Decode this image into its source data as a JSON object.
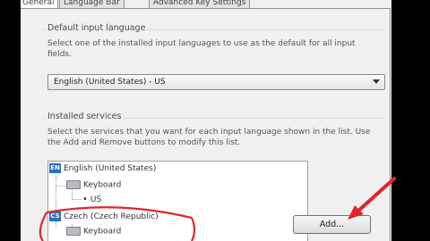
{
  "tabs": [
    {
      "label": "General",
      "active": true
    },
    {
      "label": "Language Bar",
      "active": false
    },
    {
      "label": "Advanced Key Settings",
      "active": false
    }
  ],
  "default_language": {
    "group_title": "Default input language",
    "description": "Select one of the installed input languages to use as the default for all input fields.",
    "selected": "English (United States) - US"
  },
  "installed_services": {
    "group_title": "Installed services",
    "description": "Select the services that you want for each input language shown in the list. Use the Add and Remove buttons to modify this list.",
    "languages": [
      {
        "badge": "EN",
        "name": "English (United States)",
        "category": "Keyboard",
        "layout": "US"
      },
      {
        "badge": "CS",
        "name": "Czech (Czech Republic)",
        "category": "Keyboard"
      }
    ],
    "add_label": "Add..."
  },
  "colors": {
    "annotation": "#e0262b",
    "badge": "#2b6fb4"
  }
}
